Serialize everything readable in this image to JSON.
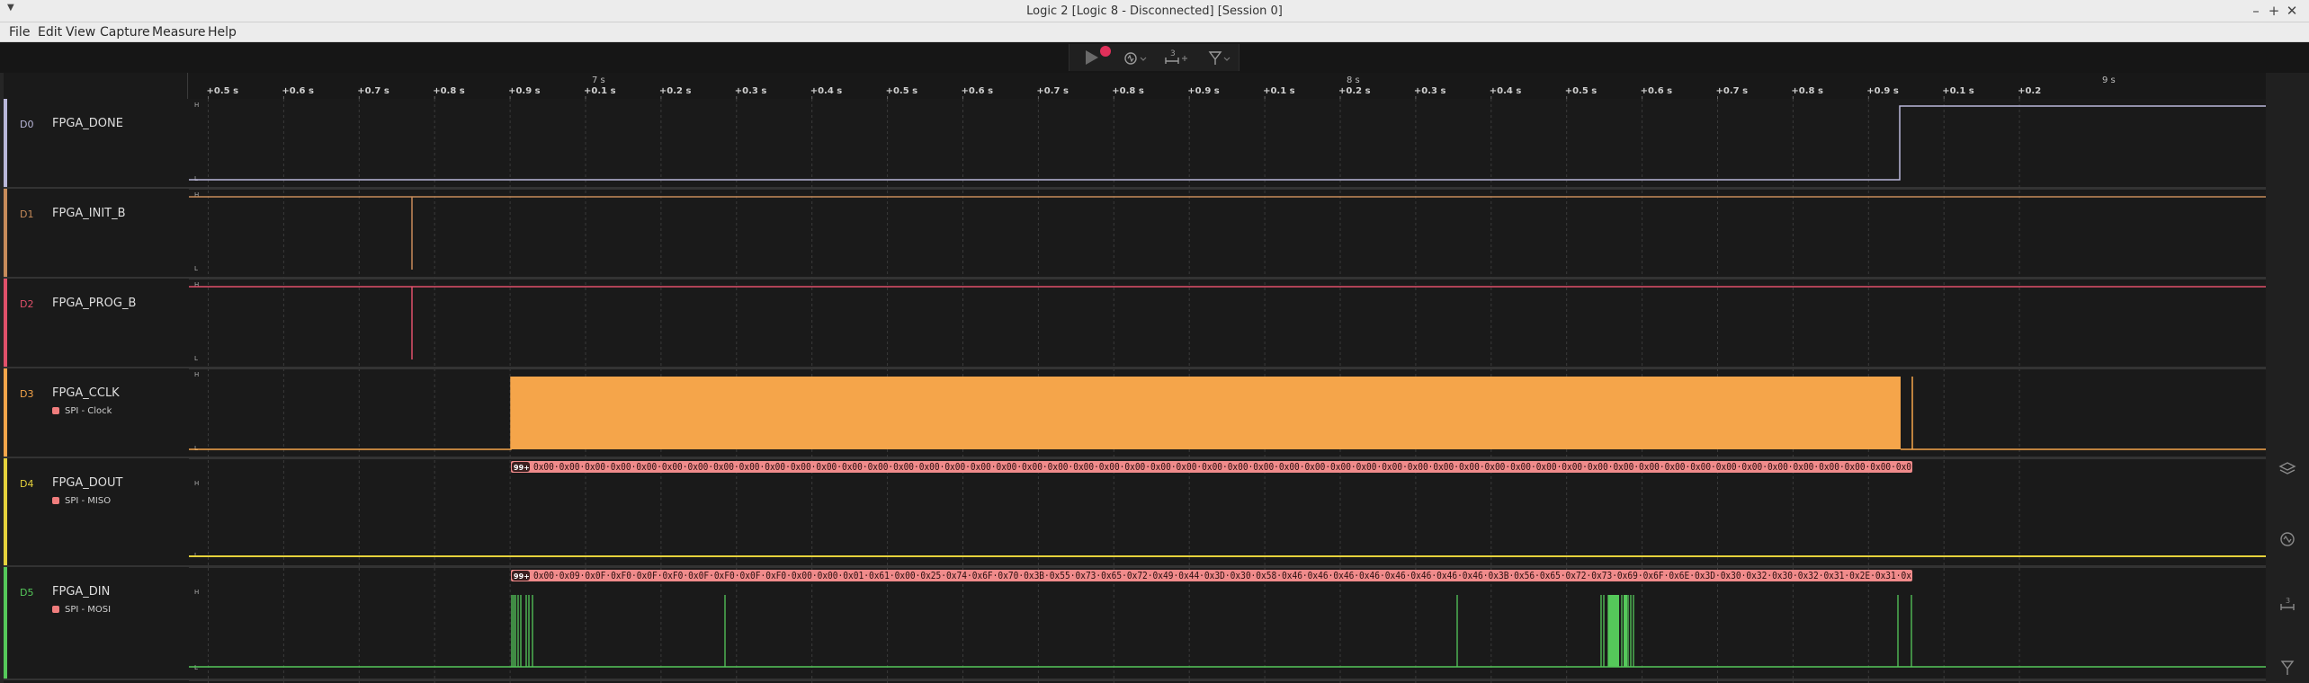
{
  "window": {
    "title": "Logic 2 [Logic 8 - Disconnected] [Session 0]"
  },
  "menu": [
    "File",
    "Edit",
    "View",
    "Capture",
    "Measure",
    "Help"
  ],
  "toolbar": {
    "icons": [
      "play-icon",
      "record-indicator",
      "trigger-icon",
      "timing-marker-icon",
      "marker-icon"
    ],
    "marker_count": "3"
  },
  "timeline": {
    "ticks": [
      "+0.5 s",
      "+0.6 s",
      "+0.7 s",
      "+0.8 s",
      "+0.9 s",
      "+0.1 s",
      "+0.2 s",
      "+0.3 s",
      "+0.4 s",
      "+0.5 s",
      "+0.6 s",
      "+0.7 s",
      "+0.8 s",
      "+0.9 s",
      "+0.1 s",
      "+0.2 s",
      "+0.3 s",
      "+0.4 s",
      "+0.5 s",
      "+0.6 s",
      "+0.7 s",
      "+0.8 s",
      "+0.9 s",
      "+0.1 s",
      "+0.2"
    ],
    "majors": [
      "7 s",
      "8 s",
      "9 s"
    ]
  },
  "channels": [
    {
      "num": "D0",
      "name": "FPGA_DONE",
      "color": "#b9b7d9",
      "analyzer": null
    },
    {
      "num": "D1",
      "name": "FPGA_INIT_B",
      "color": "#c78b5a",
      "analyzer": null
    },
    {
      "num": "D2",
      "name": "FPGA_PROG_B",
      "color": "#e0506a",
      "analyzer": null
    },
    {
      "num": "D3",
      "name": "FPGA_CCLK",
      "color": "#f5a54a",
      "analyzer": "SPI - Clock"
    },
    {
      "num": "D4",
      "name": "FPGA_DOUT",
      "color": "#e6d23c",
      "analyzer": "SPI - MISO"
    },
    {
      "num": "D5",
      "name": "FPGA_DIN",
      "color": "#55c85a",
      "analyzer": "SPI - MOSI"
    }
  ],
  "decodes": {
    "badge": "99+",
    "miso": "0x00·0x00·0x00·0x00·0x00·0x00·0x00·0x00·0x00·0x00·0x00·0x00·0x00·0x00·0x00·0x00·0x00·0x00·0x00·0x00·0x00·0x00·0x00·0x00·0x00·0x00·0x00·0x00·0x00·0x00·0x00·0x00·0x00·0x00·0x00·0x00·0x00·0x00·0x00·0x00·0x00·0x00·0x00·0x00·0x00·0x00·0x00·0x00·0x00·0x00·0x00·0x00·0x00·0x0",
    "mosi": "0x00·0x09·0x0F·0xF0·0x0F·0xF0·0x0F·0xF0·0x0F·0xF0·0x00·0x00·0x01·0x61·0x00·0x25·0x74·0x6F·0x70·0x3B·0x55·0x73·0x65·0x72·0x49·0x44·0x3D·0x30·0x58·0x46·0x46·0x46·0x46·0x46·0x46·0x46·0x46·0x3B·0x56·0x65·0x72·0x73·0x69·0x6F·0x6E·0x3D·0x30·0x32·0x30·0x32·0x31·0x2E·0x31·0x"
  },
  "right_icons": [
    "layers-icon",
    "trigger-icon",
    "timing-marker-icon",
    "marker-icon"
  ]
}
